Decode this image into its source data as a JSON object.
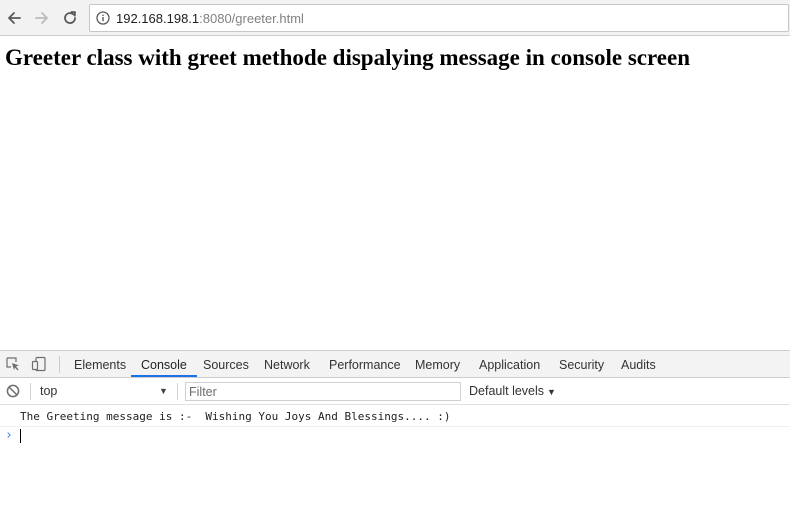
{
  "browser": {
    "url_host": "192.168.198.1",
    "url_path": ":8080/greeter.html",
    "icons": {
      "back": "back-arrow-icon",
      "forward": "forward-arrow-icon",
      "reload": "reload-icon",
      "site_info": "info-icon"
    }
  },
  "page": {
    "heading": "Greeter class with greet methode dispalying message in console screen"
  },
  "devtools": {
    "tabs": [
      {
        "label": "Elements",
        "active": false
      },
      {
        "label": "Console",
        "active": true
      },
      {
        "label": "Sources",
        "active": false
      },
      {
        "label": "Network",
        "active": false
      },
      {
        "label": "Performance",
        "active": false
      },
      {
        "label": "Memory",
        "active": false
      },
      {
        "label": "Application",
        "active": false
      },
      {
        "label": "Security",
        "active": false
      },
      {
        "label": "Audits",
        "active": false
      }
    ],
    "console": {
      "context": "top",
      "filter_placeholder": "Filter",
      "levels_label": "Default levels",
      "messages": [
        "The Greeting message is :-  Wishing You Joys And Blessings.... :)"
      ],
      "prompt_symbol": "›"
    },
    "colors": {
      "active_tab_underline": "#1a73e8",
      "prompt": "#367cf1"
    }
  }
}
